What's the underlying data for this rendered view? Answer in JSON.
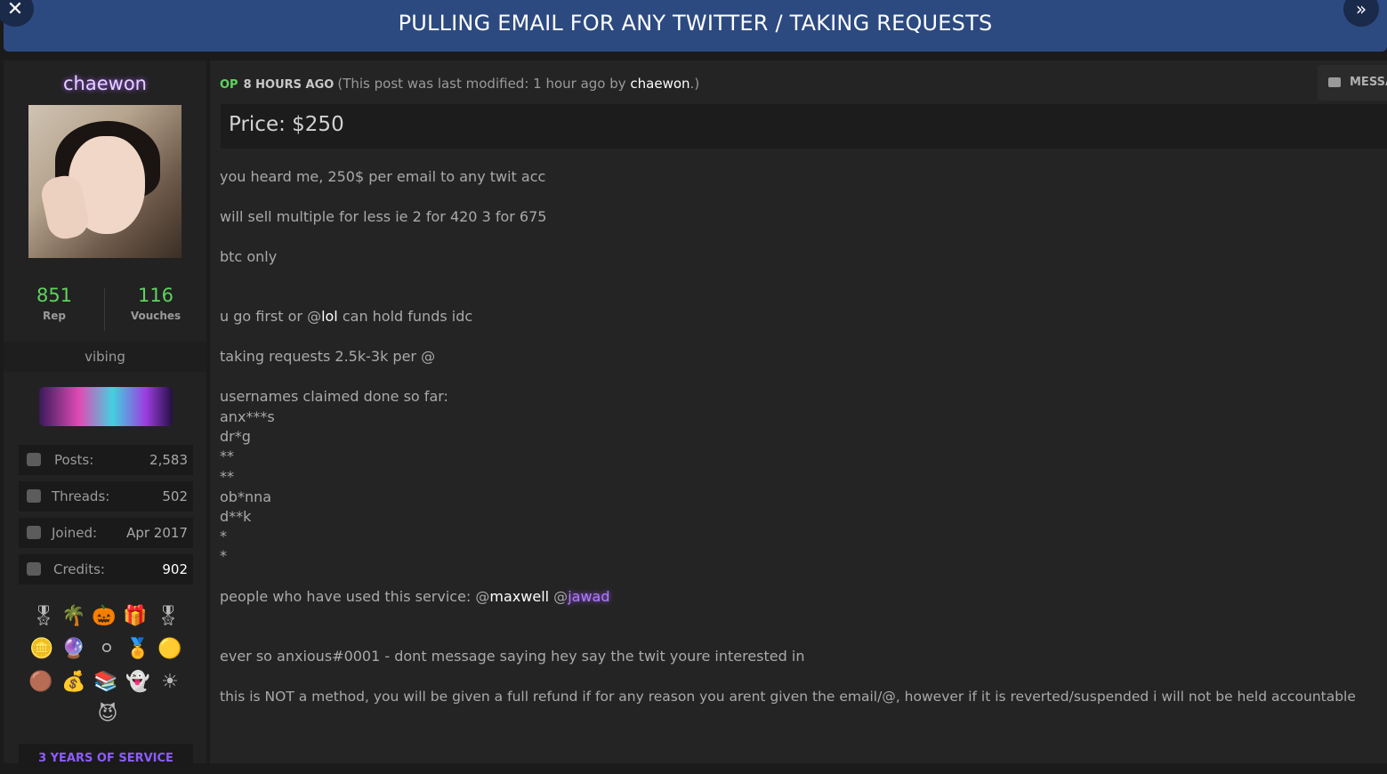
{
  "header": {
    "title": "PULLING EMAIL FOR ANY TWITTER / TAKING REQUESTS",
    "close_icon": "close-icon",
    "next_icon": "double-chevron-right-icon"
  },
  "user": {
    "name": "chaewon",
    "rep": "851",
    "rep_label": "Rep",
    "vouches": "116",
    "vouches_label": "Vouches",
    "usertitle": "vibing",
    "info": [
      {
        "label": "Posts:",
        "value": "2,583",
        "icon": "posts-icon"
      },
      {
        "label": "Threads:",
        "value": "502",
        "icon": "threads-icon"
      },
      {
        "label": "Joined:",
        "value": "Apr 2017",
        "icon": "calendar-icon"
      },
      {
        "label": "Credits:",
        "value": "902",
        "icon": "credits-icon"
      }
    ],
    "service": "3 YEARS OF SERVICE"
  },
  "post": {
    "op": "OP",
    "time": "8 HOURS AGO",
    "modified_prefix": "(This post was last modified: 1 hour ago by ",
    "modified_by": "chaewon",
    "modified_suffix": ".)",
    "message_button": "MESSAGE",
    "price": "Price: $250",
    "lines": {
      "l1": "you heard me, 250$ per email to any twit acc",
      "l2": "will sell multiple for less ie 2 for 420 3 for 675",
      "l3": "btc only",
      "l4_pre": "u go first or @",
      "l4_mention": "lol",
      "l4_post": " can hold funds idc",
      "l5": "taking requests 2.5k-3k per @",
      "l6": "usernames claimed done so far:",
      "u1": "anx***s",
      "u2": "dr*g",
      "u3": "**",
      "u4": "**",
      "u5": "ob*nna",
      "u6": "d**k",
      "u7": "*",
      "u8": "*",
      "l7_pre": "people who have used this service: @",
      "l7_m1": "maxwell",
      "l7_mid": " @",
      "l7_m2": "jawad",
      "l8": "ever so anxious#0001 - dont message saying hey say the twit youre interested in",
      "l9": "this is NOT a method, you will be given a full refund if for any reason you arent given the email/@, however if it is reverted/suspended i will not be held accountable"
    }
  }
}
